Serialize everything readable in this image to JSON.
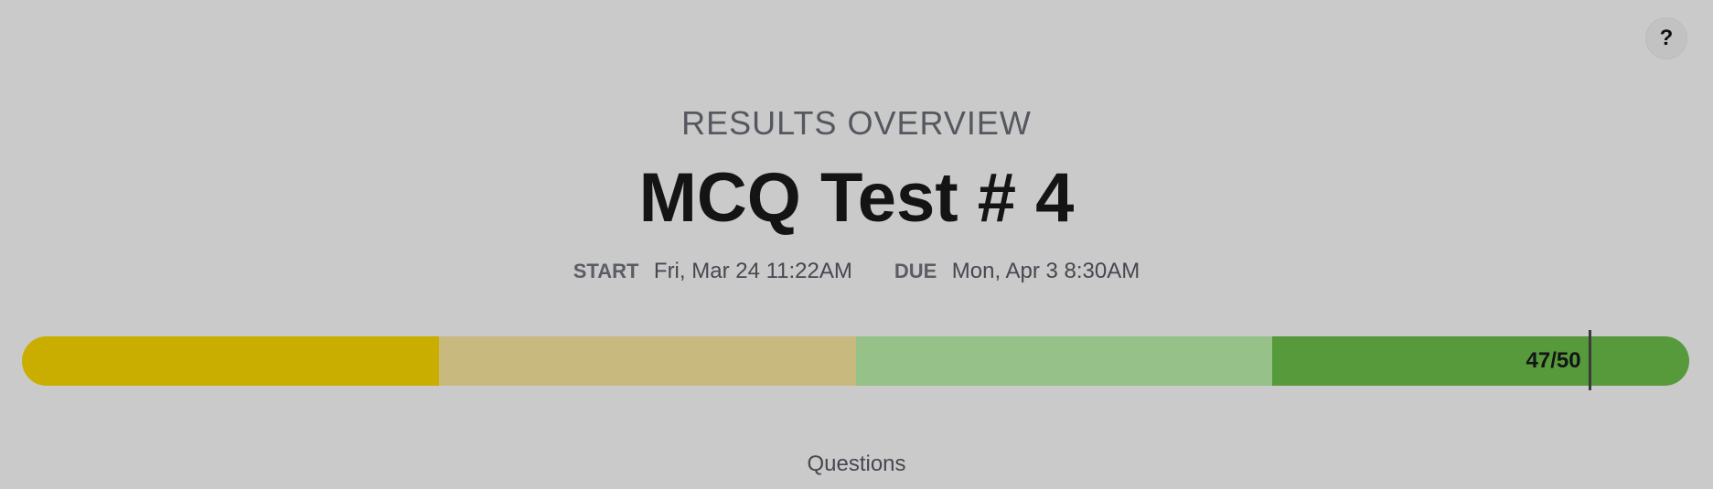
{
  "help": {
    "label": "?"
  },
  "header": {
    "subtitle": "RESULTS OVERVIEW",
    "title": "MCQ Test # 4"
  },
  "dates": {
    "start_label": "START",
    "start_value": "Fri, Mar 24 11:22AM",
    "due_label": "DUE",
    "due_value": "Mon, Apr 3 8:30AM"
  },
  "progress": {
    "score_text": "47/50",
    "score": 47,
    "max": 50,
    "segment_colors": [
      "#c9ae00",
      "#c8b97e",
      "#96c188",
      "#569a3c"
    ]
  },
  "section": {
    "questions_label": "Questions"
  }
}
